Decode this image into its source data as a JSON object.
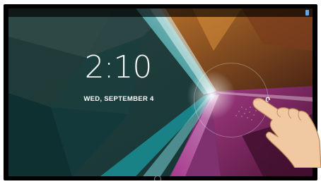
{
  "lockscreen": {
    "time": "2:10",
    "date": "WED, SEPTEMBER 4"
  },
  "icons": {
    "unlock": "unlocked-padlock-icon",
    "home": "home-circle-icon",
    "hand": "pointing-hand-icon"
  },
  "colors": {
    "clock_text": "#f4f6f6",
    "wallpaper_teal": "#1c4a48",
    "wallpaper_orange": "#c47a2a",
    "wallpaper_magenta": "#8e2a6c"
  }
}
